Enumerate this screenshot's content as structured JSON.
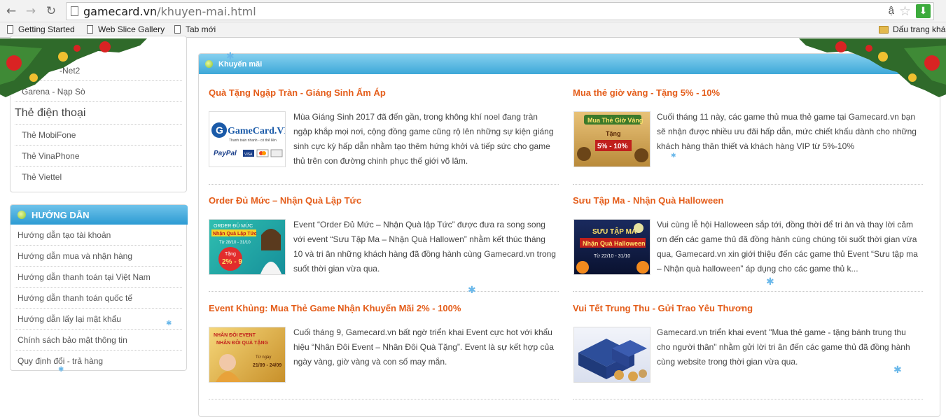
{
  "browser": {
    "url_host": "gamecard.vn",
    "url_path": "/khuyen-mai.html",
    "translate_glyph": "ậ",
    "bookmarks": [
      {
        "label": "Getting Started"
      },
      {
        "label": "Web Slice Gallery"
      },
      {
        "label": "Tab mới"
      }
    ],
    "bookmark_folder": "Dấu trang khá"
  },
  "sidebar": {
    "partial_top_item": "-Net2",
    "top_items": [
      "Garena - Nạp Sò"
    ],
    "phone_heading": "Thẻ điện thoại",
    "phone_items": [
      "Thẻ MobiFone",
      "Thẻ VinaPhone",
      "Thẻ Viettel"
    ],
    "guide_title": "HƯỚNG DẪN",
    "guide_items": [
      "Hướng dẫn tạo tài khoản",
      "Hướng dẫn mua và nhận hàng",
      "Hướng dẫn thanh toán tại Việt Nam",
      "Hướng dẫn thanh toán quốc tế",
      "Hướng dẫn lấy lại mật khẩu",
      "Chính sách bảo mật thông tin",
      "Quy định đổi - trả hàng"
    ]
  },
  "main": {
    "title": "Khuyến mãi",
    "promos": [
      {
        "title": "Quà Tặng Ngập Tràn - Giáng Sinh Ấm Áp",
        "desc": "Mùa Giáng Sinh 2017 đã đến gần, trong không khí noel đang tràn ngập khắp mọi nơi, cộng đồng game cũng rộ lên những sự kiện giáng sinh cực kỳ hấp dẫn nhằm tạo thêm hứng khởi và tiếp sức cho game thủ trên con đường chinh phục thế giới võ lâm.",
        "thumb": {
          "logo": "GameCard.VN",
          "tagline": "Thanh toán nhanh - có thể liền",
          "paypal": "PayPal",
          "visa": "VISA"
        }
      },
      {
        "title": "Mua thẻ giờ vàng - Tặng 5% - 10%",
        "desc": "Cuối tháng 11 này, các game thủ mua thẻ game tại Gamecard.vn bạn sẽ nhận được nhiều ưu đãi hấp dẫn, mức chiết khấu dành cho những khách hàng thân thiết và khách hàng VIP từ 5%-10%",
        "thumb": {
          "line1": "Mua Thẻ Giờ Vàng",
          "line2": "Tặng",
          "line3": "5% - 10%"
        }
      },
      {
        "title": "Order Đủ Mức – Nhận Quà Lập Tức",
        "desc": "Event “Order Đủ Mức – Nhận Quà lập Tức” được đưa ra song song với event “Sưu Tập Ma – Nhận Quà Hallowen” nhằm kết thúc tháng 10 và tri ân những khách hàng đã đồng hành cùng Gamecard.vn trong suốt thời gian vừa qua.",
        "thumb": {
          "line1": "ORDER ĐỦ MỨC",
          "line2": "Nhận Quà Lập Tức",
          "line3": "Từ 28/10 - 31/10",
          "line4": "Tặng",
          "line5": "2% - 9"
        }
      },
      {
        "title": "Sưu Tập Ma - Nhận Quà Halloween",
        "desc": "Vui cùng lễ hội Halloween sắp tới, đồng thời để tri ân và thay lời cảm ơn đến các game thủ đã đồng hành cùng chúng tôi suốt thời gian vừa qua, Gamecard.vn xin giới thiệu đến các game thủ Event “Sưu tập ma – Nhận quà halloween” áp dụng cho các game thủ k...",
        "thumb": {
          "line1": "SƯU TẬP MA",
          "line2": "Nhận Quà Halloween",
          "line3": "Từ 22/10 - 31/10"
        }
      },
      {
        "title": "Event Khủng: Mua Thẻ Game Nhận Khuyến Mãi 2% - 100%",
        "desc": "Cuối tháng 9, Gamecard.vn bất ngờ triển khai Event cực hot với khẩu hiệu “Nhân Đôi Event – Nhân Đôi Quà Tặng”. Event là sự kết hợp của ngày vàng, giờ vàng và con số may mắn.",
        "thumb": {
          "line1": "NHÂN ĐÔI EVENT",
          "line2": "NHÂN ĐÔI QUÀ TẶNG",
          "line3": "Từ ngày",
          "line4": "21/09 - 24/09"
        }
      },
      {
        "title": "Vui Tết Trung Thu - Gửi Trao Yêu Thương",
        "desc": "Gamecard.vn triển khai event \"Mua thẻ game - tặng bánh trung thu cho người thân\" nhằm gửi lời tri ân đến các game thủ đã đồng hành cùng website trong thời gian vừa qua.",
        "thumb": {}
      }
    ]
  },
  "colors": {
    "accent_orange": "#e45d1a",
    "header_blue": "#3da8d8"
  }
}
